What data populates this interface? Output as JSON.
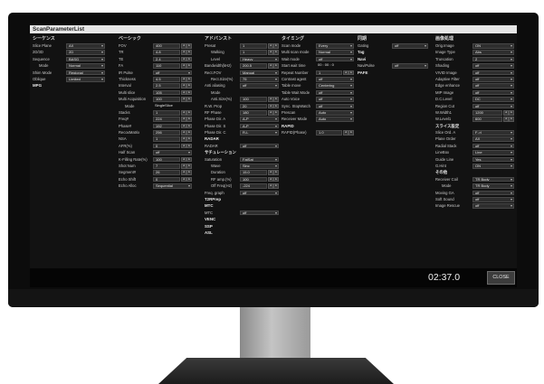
{
  "window": {
    "title": "ScanParameterList"
  },
  "status": {
    "timer": "02:37.0",
    "close_label": "CLOSE"
  },
  "columns": [
    {
      "header": "シーケンス",
      "rows": [
        {
          "label": "Slice Plane",
          "value": "AX",
          "dd": true
        },
        {
          "label": "2D/3D",
          "value": "2D",
          "dd": true
        },
        {
          "label": "Sequence",
          "value": "BASG",
          "dd": true
        },
        {
          "label": "Mode",
          "value": "Normal",
          "dd": true,
          "indent": true
        },
        {
          "label": "Shim Mode",
          "value": "Regional",
          "dd": true
        },
        {
          "label": "Oblique",
          "value": "Limited",
          "dd": true
        },
        {
          "section": "MPG"
        }
      ]
    },
    {
      "header": "ベーシック",
      "rows": [
        {
          "label": "FOV",
          "value": "400",
          "arrows": true
        },
        {
          "label": "TR",
          "value": "4.8",
          "arrows": true
        },
        {
          "label": "TE",
          "value": "2.4",
          "arrows": true
        },
        {
          "label": "FA",
          "value": "110",
          "arrows": true
        },
        {
          "label": "IR Pulse",
          "value": "off",
          "dd": true
        },
        {
          "label": "Thickness",
          "value": "4.5",
          "arrows": true
        },
        {
          "label": "Interval",
          "value": "2.5",
          "arrows": true
        },
        {
          "label": "Multi slice",
          "value": "105",
          "arrows": true
        },
        {
          "label": "Multi Acquisition",
          "value": "100",
          "arrows": true
        },
        {
          "label": "Mode",
          "value": "SingleSlice",
          "plain": true,
          "indent": true
        },
        {
          "label": "Stacks",
          "value": "1",
          "arrows": true
        },
        {
          "label": "Freq#",
          "value": "224",
          "arrows": true
        },
        {
          "label": "Phase#",
          "value": "192",
          "arrows": true
        },
        {
          "label": "RecoxMatrix",
          "value": "256",
          "arrows": true
        },
        {
          "label": "NSA",
          "value": "1",
          "arrows": true
        },
        {
          "label": "AFR(%)",
          "value": "0",
          "arrows": true
        },
        {
          "label": "Half Scan",
          "value": "off",
          "dd": true
        },
        {
          "label": "K-Filling Rate(%)",
          "value": "100",
          "arrows": true
        },
        {
          "label": "Shot Num",
          "value": "7",
          "arrows": true
        },
        {
          "label": "Segment#",
          "value": "26",
          "arrows": true
        },
        {
          "label": "Echo Shift",
          "value": "0",
          "arrows": true
        },
        {
          "label": "Echo Alloc",
          "value": "Sequential",
          "dd": true
        }
      ]
    },
    {
      "header": "アドバンスト",
      "rows": [
        {
          "label": "Presat",
          "value": "1",
          "arrows": true
        },
        {
          "label": "Walking",
          "value": "1",
          "arrows": true,
          "indent": true
        },
        {
          "label": "Level",
          "value": "Heavy",
          "dd": true,
          "indent": true
        },
        {
          "label": "Bandwidth(kHz)",
          "value": "200.5",
          "arrows": true
        },
        {
          "label": "Rect.FOV",
          "value": "Manual",
          "dd": true
        },
        {
          "label": "Rect.Size(%)",
          "value": "75",
          "dd": true,
          "indent": true
        },
        {
          "label": "Anti aliasing",
          "value": "off",
          "dd": true
        },
        {
          "label": "Mode",
          "value": "",
          "plain": true,
          "indent": true
        },
        {
          "label": "Anti.Size(%)",
          "value": "100",
          "arrows": true,
          "indent": true
        },
        {
          "label": "R.W. Prop",
          "value": "20",
          "arrows": true
        },
        {
          "label": "RF Phase",
          "value": "180",
          "arrows": true
        },
        {
          "label": "Phase Dir. A",
          "value": "A-P",
          "dd": true
        },
        {
          "label": "Phase Dir. S",
          "value": "A-P",
          "dd": true
        },
        {
          "label": "Phase Dir. C",
          "value": "R-L",
          "dd": true
        },
        {
          "section": "RADAR"
        },
        {
          "label": "RADAR",
          "value": "off",
          "dd": true
        },
        {
          "section": "サチュレーション"
        },
        {
          "label": "Saturation",
          "value": "FatSat",
          "dd": true
        },
        {
          "label": "Wave",
          "value": "Sinc",
          "dd": true,
          "indent": true
        },
        {
          "label": "Duration",
          "value": "15.0",
          "arrows": true,
          "indent": true
        },
        {
          "label": "RF amp.(%)",
          "value": "100",
          "arrows": true,
          "indent": true
        },
        {
          "label": "Off Freq(Hz)",
          "value": "-224",
          "arrows": true,
          "indent": true
        },
        {
          "label": "Freq. graph",
          "value": "off",
          "dd": true
        },
        {
          "section": "T2RPrep"
        },
        {
          "section": "MTC"
        },
        {
          "label": "MTC",
          "value": "off",
          "dd": true
        },
        {
          "section": "VENC"
        },
        {
          "section": "SSP"
        },
        {
          "section": "ASL"
        }
      ]
    },
    {
      "header": "タイミング",
      "rows": [
        {
          "label": "Scan mode",
          "value": "Every",
          "dd": true
        },
        {
          "label": "Multi scan mode",
          "value": "Normal",
          "dd": true
        },
        {
          "label": "Wait mode",
          "value": "off",
          "dd": true
        },
        {
          "label": "Start wait time",
          "value": "00 : 00 : 0",
          "plain": true
        },
        {
          "label": "Repeat Number",
          "value": "1",
          "arrows": true
        },
        {
          "label": "Contrast agent",
          "value": "off",
          "dd": true
        },
        {
          "label": "Table move",
          "value": "Centering",
          "dd": true
        },
        {
          "label": "Table Wait Mode",
          "value": "off",
          "dd": true
        },
        {
          "label": "Auto Voice",
          "value": "off",
          "dd": true
        },
        {
          "label": "Sync. StopWatch",
          "value": "off",
          "dd": true
        },
        {
          "label": "Prescan",
          "value": "Auto",
          "dd": true
        },
        {
          "label": "Receiver Mode",
          "value": "Auto",
          "dd": true
        },
        {
          "section": "RAPID"
        },
        {
          "label": "RAPID(Phase)",
          "value": "1.0",
          "arrows": true
        }
      ]
    },
    {
      "header": "同期",
      "rows": [
        {
          "label": "Gating",
          "value": "off",
          "dd": true
        },
        {
          "section": "Tag"
        },
        {
          "section": "Navi"
        },
        {
          "label": "NaviPulse",
          "value": "off",
          "dd": true
        },
        {
          "section": "PAFE"
        }
      ]
    },
    {
      "header": "画像処理",
      "rows": [
        {
          "label": "Orig.Image",
          "value": "ON",
          "dd": true
        },
        {
          "label": "Image Type",
          "value": "Abs",
          "dd": true
        },
        {
          "label": "Truncation",
          "value": "2",
          "dd": true
        },
        {
          "label": "Shading",
          "value": "off",
          "dd": true
        },
        {
          "label": "VIVID Image",
          "value": "off",
          "dd": true
        },
        {
          "label": "Adaptive Filter",
          "value": "off",
          "dd": true
        },
        {
          "label": "Edge enhance",
          "value": "off",
          "dd": true
        },
        {
          "label": "MIP Image",
          "value": "off",
          "dd": true
        },
        {
          "label": "D.C.Level",
          "value": "DC",
          "dd": true
        },
        {
          "label": "Region Cut",
          "value": "off",
          "dd": true
        },
        {
          "label": "W.Width1",
          "value": "1200",
          "arrows": true
        },
        {
          "label": "W.Level1",
          "value": "600",
          "arrows": true
        },
        {
          "section": "スライス設定"
        },
        {
          "label": "Slice Ord. A",
          "value": "F->I",
          "dd": true
        },
        {
          "label": "Plane Order",
          "value": "AX",
          "dd": true
        },
        {
          "label": "Radial Stack",
          "value": "off",
          "dd": true
        },
        {
          "label": "LineBox",
          "value": "Line",
          "dd": true
        },
        {
          "label": "Guide Line",
          "value": "Yes",
          "dd": true
        },
        {
          "label": "G.Hint",
          "value": "ON",
          "dd": true
        },
        {
          "section": "その他"
        },
        {
          "label": "Receiver Coil",
          "value": "TR Body",
          "dd": true
        },
        {
          "label": "Mode",
          "value": "TR Body",
          "dd": true,
          "indent": true
        },
        {
          "label": "Moving GA",
          "value": "off",
          "dd": true
        },
        {
          "label": "Soft Sound",
          "value": "off",
          "dd": true
        },
        {
          "label": "Image Rescue",
          "value": "off",
          "dd": true
        }
      ]
    }
  ]
}
